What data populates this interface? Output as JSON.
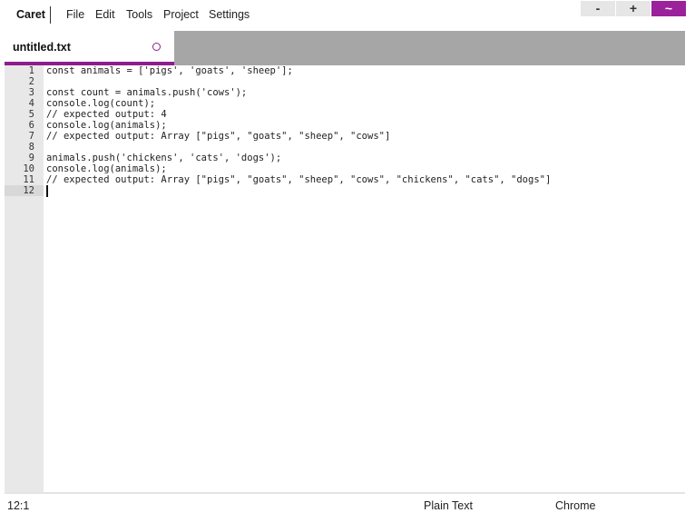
{
  "app": {
    "name": "Caret"
  },
  "menu": [
    {
      "id": "file",
      "label": "File"
    },
    {
      "id": "edit",
      "label": "Edit"
    },
    {
      "id": "tools",
      "label": "Tools"
    },
    {
      "id": "project",
      "label": "Project"
    },
    {
      "id": "settings",
      "label": "Settings"
    }
  ],
  "window_controls": {
    "minimize": "-",
    "maximize": "+",
    "menu": "~"
  },
  "tab": {
    "filename": "untitled.txt",
    "dirty_indicator_icon": "modified-circle-icon"
  },
  "editor": {
    "lines": [
      "const animals = ['pigs', 'goats', 'sheep'];",
      "",
      "const count = animals.push('cows');",
      "console.log(count);",
      "// expected output: 4",
      "console.log(animals);",
      "// expected output: Array [\"pigs\", \"goats\", \"sheep\", \"cows\"]",
      "",
      "animals.push('chickens', 'cats', 'dogs');",
      "console.log(animals);",
      "// expected output: Array [\"pigs\", \"goats\", \"sheep\", \"cows\", \"chickens\", \"cats\", \"dogs\"]",
      ""
    ],
    "line_numbers": [
      "1",
      "2",
      "3",
      "4",
      "5",
      "6",
      "7",
      "8",
      "9",
      "10",
      "11",
      "12"
    ]
  },
  "status": {
    "position": "12:1",
    "mode": "Plain Text",
    "theme": "Chrome"
  },
  "colors": {
    "accent": "#8e1d8e",
    "tabbar": "#a6a6a6",
    "gutter": "#e8e8e8"
  }
}
